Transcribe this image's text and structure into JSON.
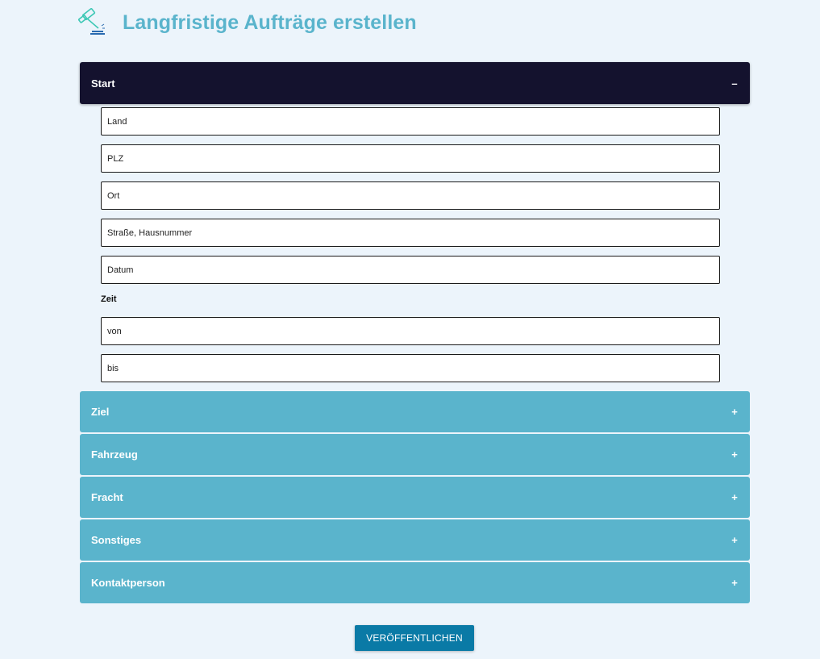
{
  "header": {
    "title": "Langfristige Aufträge erstellen",
    "logo_icon": "gavel-icon"
  },
  "colors": {
    "title": "#5ab4cc",
    "active_section": "#14122e",
    "collapsed_section": "#5ab4cc",
    "submit_button": "#0a7aa6",
    "background": "#ecf4fb"
  },
  "sections": {
    "start": {
      "label": "Start",
      "toggle": "–",
      "fields": {
        "land": "Land",
        "plz": "PLZ",
        "ort": "Ort",
        "strasse": "Straße, Hausnummer",
        "datum": "Datum"
      },
      "zeit_label": "Zeit",
      "zeit_fields": {
        "von": "von",
        "bis": "bis"
      }
    },
    "ziel": {
      "label": "Ziel",
      "toggle": "+"
    },
    "fahrzeug": {
      "label": "Fahrzeug",
      "toggle": "+"
    },
    "fracht": {
      "label": "Fracht",
      "toggle": "+"
    },
    "sonstiges": {
      "label": "Sonstiges",
      "toggle": "+"
    },
    "kontaktperson": {
      "label": "Kontaktperson",
      "toggle": "+"
    }
  },
  "submit_label": "VERÖFFENTLICHEN"
}
